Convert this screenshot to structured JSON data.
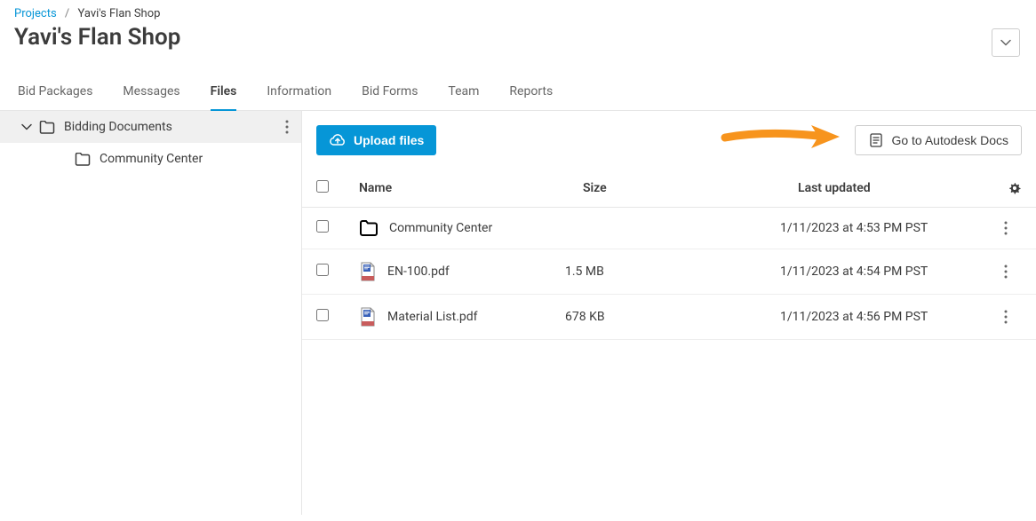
{
  "breadcrumb": {
    "root": "Projects",
    "current": "Yavi's Flan Shop"
  },
  "page_title": "Yavi's Flan Shop",
  "tabs": [
    {
      "label": "Bid Packages",
      "active": false
    },
    {
      "label": "Messages",
      "active": false
    },
    {
      "label": "Files",
      "active": true
    },
    {
      "label": "Information",
      "active": false
    },
    {
      "label": "Bid Forms",
      "active": false
    },
    {
      "label": "Team",
      "active": false
    },
    {
      "label": "Reports",
      "active": false
    }
  ],
  "sidebar": {
    "items": [
      {
        "label": "Bidding Documents",
        "active": true,
        "expanded": true
      },
      {
        "label": "Community Center",
        "active": false,
        "child": true
      }
    ]
  },
  "toolbar": {
    "upload_label": "Upload files",
    "docs_label": "Go to Autodesk Docs"
  },
  "table": {
    "headers": {
      "name": "Name",
      "size": "Size",
      "updated": "Last updated"
    },
    "rows": [
      {
        "type": "folder",
        "name": "Community Center",
        "size": "",
        "updated": "1/11/2023 at 4:53 PM PST"
      },
      {
        "type": "pdf",
        "name": "EN-100.pdf",
        "size": "1.5 MB",
        "updated": "1/11/2023 at 4:54 PM PST"
      },
      {
        "type": "pdf",
        "name": "Material List.pdf",
        "size": "678 KB",
        "updated": "1/11/2023 at 4:56 PM PST"
      }
    ]
  }
}
